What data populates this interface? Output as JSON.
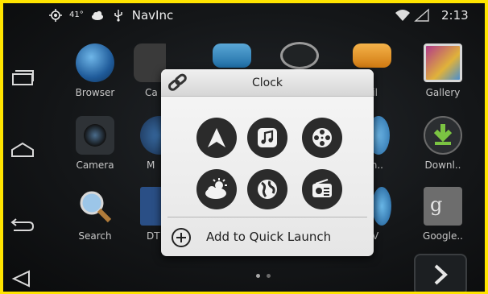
{
  "status_bar": {
    "temperature": "41°",
    "app_name": "NavInc",
    "time": "2:13"
  },
  "apps": [
    {
      "label": "Browser",
      "icon": "globe-icon"
    },
    {
      "label": "Ca",
      "icon": "calculator-icon"
    },
    {
      "label": "",
      "icon": "contacts-icon"
    },
    {
      "label": "",
      "icon": "clock-icon"
    },
    {
      "label": "ail",
      "icon": "email-icon"
    },
    {
      "label": "Gallery",
      "icon": "gallery-icon"
    },
    {
      "label": "Camera",
      "icon": "camera-icon"
    },
    {
      "label": "M",
      "icon": "maps-icon"
    },
    {
      "label": "eln..",
      "icon": "people-icon"
    },
    {
      "label": "Downl..",
      "icon": "download-icon"
    },
    {
      "label": "Search",
      "icon": "search-icon"
    },
    {
      "label": "DT",
      "icon": "tv-icon"
    },
    {
      "label": "V",
      "icon": "video-icon"
    },
    {
      "label": "Google..",
      "icon": "google-settings-icon"
    }
  ],
  "dialog": {
    "title": "Clock",
    "quick_launch_items": [
      {
        "icon": "navigation-arrow-icon"
      },
      {
        "icon": "music-note-icon"
      },
      {
        "icon": "film-reel-icon"
      },
      {
        "icon": "weather-icon"
      },
      {
        "icon": "globe-icon"
      },
      {
        "icon": "radio-icon"
      }
    ],
    "add_label": "Add to Quick Launch"
  },
  "colors": {
    "frame": "#ffe400",
    "time_accent": "#33b5e5",
    "dialog_bg": "#eeeeee",
    "button_dark": "#2b2b2b"
  }
}
